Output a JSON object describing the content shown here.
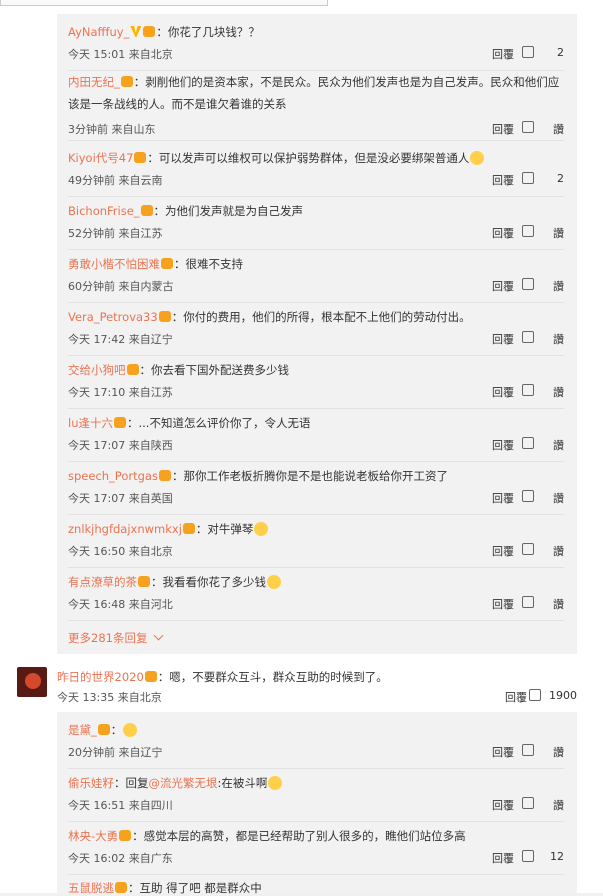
{
  "replies": [
    {
      "user": "AyNafffuy_",
      "text": "你花了几块钱？？",
      "time": "今天 15:01",
      "location": "来自北京",
      "reply_label": "回覆",
      "likes": "2",
      "badges": [
        "v",
        "svip"
      ]
    },
    {
      "user": "内田无纪_",
      "text": "剥削他们的是资本家，不是民众。民众为他们发声也是为自己发声。民众和他们应该是一条战线的人。而不是谁欠着谁的关系",
      "time": "3分钟前",
      "location": "来自山东",
      "reply_label": "回覆",
      "likes": "讚",
      "badges": [
        "svip"
      ]
    },
    {
      "user": "Kiyoi代号47",
      "text": "可以发声可以维权可以保护弱势群体，但是没必要绑架普通人",
      "time": "49分钟前",
      "location": "来自云南",
      "reply_label": "回覆",
      "likes": "2",
      "badges": [
        "svip"
      ]
    },
    {
      "user": "BichonFrise_",
      "text": "为他们发声就是为自己发声",
      "time": "52分钟前",
      "location": "来自江苏",
      "reply_label": "回覆",
      "likes": "讚",
      "badges": [
        "svip"
      ]
    },
    {
      "user": "勇敢小楷不怕困难",
      "text": "很难不支持",
      "time": "60分钟前",
      "location": "来自内蒙古",
      "reply_label": "回覆",
      "likes": "讚",
      "badges": [
        "svip"
      ]
    },
    {
      "user": "Vera_Petrova33",
      "text": "你付的费用，他们的所得，根本配不上他们的劳动付出。",
      "time": "今天 17:42",
      "location": "来自辽宁",
      "reply_label": "回覆",
      "likes": "讚",
      "badges": [
        "svip"
      ]
    },
    {
      "user": "交给小狗吧",
      "text": "你去看下国外配送费多少钱",
      "time": "今天 17:10",
      "location": "来自江苏",
      "reply_label": "回覆",
      "likes": "讚",
      "badges": [
        "svip"
      ]
    },
    {
      "user": "lu逢十六",
      "text": "...不知道怎么评价你了，令人无语",
      "time": "今天 17:07",
      "location": "来自陕西",
      "reply_label": "回覆",
      "likes": "讚",
      "badges": [
        "svip"
      ]
    },
    {
      "user": "speech_Portgas",
      "text": "那你工作老板折腾你是不是也能说老板给你开工资了",
      "time": "今天 17:07",
      "location": "来自英国",
      "reply_label": "回覆",
      "likes": "讚",
      "badges": [
        "svip"
      ]
    },
    {
      "user": "znlkjhgfdajxnwmkxj",
      "text": "对牛弹琴",
      "time": "今天 16:50",
      "location": "来自北京",
      "reply_label": "回覆",
      "likes": "讚",
      "badges": [
        "svip"
      ]
    },
    {
      "user": "有点潦草的茶",
      "text": "我看看你花了多少钱",
      "time": "今天 16:48",
      "location": "来自河北",
      "reply_label": "回覆",
      "likes": "讚",
      "badges": [
        "svip"
      ]
    }
  ],
  "more": "更多281条回复",
  "main_comment": {
    "user": "昨日的世界2020",
    "text": "嗯，不要群众互斗，群众互助的时候到了。",
    "time": "今天 13:35",
    "location": "来自北京",
    "reply_label": "回覆",
    "likes": "1900",
    "badges": [
      "svip"
    ]
  },
  "sub_replies": [
    {
      "user": "是黛_",
      "text": "",
      "time": "20分钟前",
      "location": "来自辽宁",
      "reply_label": "回覆",
      "likes": "讚",
      "badges": [
        "svip"
      ]
    },
    {
      "user": "偷乐娃籽",
      "reply_prefix": "回复",
      "mention": "@流光繁无垠",
      "text": "在被斗啊",
      "time": "今天 16:51",
      "location": "来自四川",
      "reply_label": "回覆",
      "likes": "讚",
      "badges": []
    },
    {
      "user": "林央-大勇",
      "text": "感觉本层的高赞，都是已经帮助了别人很多的，瞧他们站位多高",
      "time": "今天 16:02",
      "location": "来自广东",
      "reply_label": "回覆",
      "likes": "12",
      "badges": [
        "svip"
      ]
    }
  ],
  "cut_line": {
    "user": "五鼠脱逃",
    "text": "互助 得了吧 都是群众中"
  }
}
